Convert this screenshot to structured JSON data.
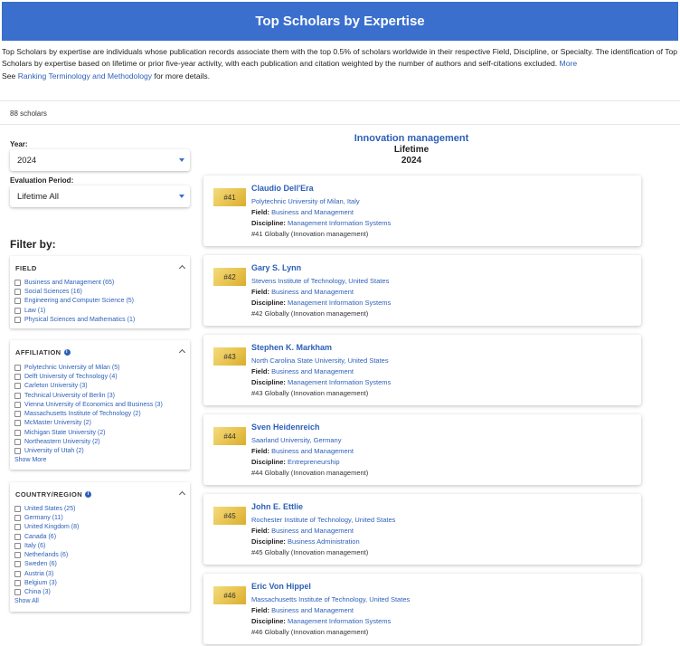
{
  "header": {
    "title": "Top Scholars by Expertise"
  },
  "intro": {
    "text": "Top Scholars by expertise are individuals whose publication records associate them with the top 0.5% of scholars worldwide in their respective Field, Discipline, or Specialty. The identification of Top Scholars by expertise based on lifetime or prior five-year activity, with each publication and citation weighted by the number of authors and self-citations excluded.",
    "more_link": "More",
    "see_prefix": "See",
    "methodology_link": "Ranking Terminology and Methodology",
    "see_suffix": "for more details."
  },
  "scholar_count": "88 scholars",
  "controls": {
    "year_label": "Year:",
    "year_value": "2024",
    "period_label": "Evaluation Period:",
    "period_value": "Lifetime All"
  },
  "filters": {
    "title": "Filter by:",
    "field": {
      "header": "FIELD",
      "options": [
        "Business and Management (65)",
        "Social Sciences (16)",
        "Engineering and Computer Science (5)",
        "Law (1)",
        "Physical Sciences and Mathematics (1)"
      ]
    },
    "affiliation": {
      "header": "AFFILIATION",
      "options": [
        "Polytechnic University of Milan (5)",
        "Delft University of Technology (4)",
        "Carleton University (3)",
        "Technical University of Berlin (3)",
        "Vienna University of Economics and Business (3)",
        "Massachusetts Institute of Technology (2)",
        "McMaster University (2)",
        "Michigan State University (2)",
        "Northeastern University (2)",
        "University of Utah (2)"
      ],
      "show_more": "Show More"
    },
    "country": {
      "header": "COUNTRY/REGION",
      "options": [
        "United States (25)",
        "Germany (11)",
        "United Kingdom (8)",
        "Canada (6)",
        "Italy (6)",
        "Netherlands (6)",
        "Sweden (6)",
        "Austria (3)",
        "Belgium (3)",
        "China (3)"
      ],
      "show_all": "Show All"
    }
  },
  "results": {
    "topic": "Innovation management",
    "period": "Lifetime",
    "year": "2024",
    "field_label": "Field:",
    "discipline_label": "Discipline:",
    "scholars": [
      {
        "rank": "#41",
        "name": "Claudio Dell'Era",
        "institution": "Polytechnic University of Milan, Italy",
        "field": "Business and Management",
        "discipline": "Management Information Systems",
        "global_rank": "#41 Globally (Innovation management)"
      },
      {
        "rank": "#42",
        "name": "Gary S. Lynn",
        "institution": "Stevens Institute of Technology, United States",
        "field": "Business and Management",
        "discipline": "Management Information Systems",
        "global_rank": "#42 Globally (Innovation management)"
      },
      {
        "rank": "#43",
        "name": "Stephen K. Markham",
        "institution": "North Carolina State University, United States",
        "field": "Business and Management",
        "discipline": "Management Information Systems",
        "global_rank": "#43 Globally (Innovation management)"
      },
      {
        "rank": "#44",
        "name": "Sven Heidenreich",
        "institution": "Saarland University, Germany",
        "field": "Business and Management",
        "discipline": "Entrepreneurship",
        "global_rank": "#44 Globally (Innovation management)"
      },
      {
        "rank": "#45",
        "name": "John E. Ettlie",
        "institution": "Rochester Institute of Technology, United States",
        "field": "Business and Management",
        "discipline": "Business Administration",
        "global_rank": "#45 Globally (Innovation management)"
      },
      {
        "rank": "#46",
        "name": "Eric Von Hippel",
        "institution": "Massachusetts Institute of Technology, United States",
        "field": "Business and Management",
        "discipline": "Management Information Systems",
        "global_rank": "#46 Globally (Innovation management)"
      }
    ]
  },
  "colors": {
    "banner": "#3a6fce",
    "link": "#2c5fb8",
    "badge_gold": "#e8c34f"
  }
}
